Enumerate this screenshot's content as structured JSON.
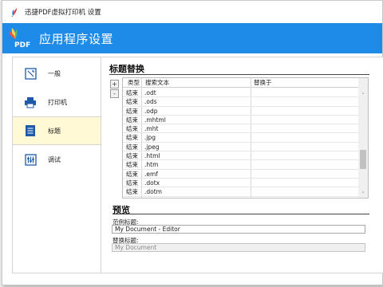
{
  "window": {
    "title": "迅捷PDF虚拟打印机 设置",
    "header_title": "应用程序设置",
    "logo_text": "PDF"
  },
  "sidebar": {
    "items": [
      {
        "label": "一般",
        "icon": "general-settings-icon",
        "active": false
      },
      {
        "label": "打印机",
        "icon": "printer-icon",
        "active": false
      },
      {
        "label": "标题",
        "icon": "title-document-icon",
        "active": true
      },
      {
        "label": "调试",
        "icon": "debug-icon",
        "active": false
      }
    ]
  },
  "title_replace": {
    "heading": "标题替换",
    "add_label": "+",
    "remove_label": "-",
    "columns": [
      "类型",
      "搜索文本",
      "替换于"
    ],
    "rows": [
      {
        "type": "结束",
        "search": ".odt",
        "replace": ""
      },
      {
        "type": "结束",
        "search": ".ods",
        "replace": ""
      },
      {
        "type": "结束",
        "search": ".odp",
        "replace": ""
      },
      {
        "type": "结束",
        "search": ".mhtml",
        "replace": ""
      },
      {
        "type": "结束",
        "search": ".mht",
        "replace": ""
      },
      {
        "type": "结束",
        "search": ".jpg",
        "replace": ""
      },
      {
        "type": "结束",
        "search": ".jpeg",
        "replace": ""
      },
      {
        "type": "结束",
        "search": ".html",
        "replace": ""
      },
      {
        "type": "结束",
        "search": ".htm",
        "replace": ""
      },
      {
        "type": "结束",
        "search": ".emf",
        "replace": ""
      },
      {
        "type": "结束",
        "search": ".dotx",
        "replace": ""
      },
      {
        "type": "结束",
        "search": ".dotm",
        "replace": ""
      },
      {
        "type": "结束",
        "search": "",
        "replace": ""
      }
    ],
    "scroll_up": "˄",
    "scroll_down": "˅"
  },
  "preview": {
    "heading": "预览",
    "sample_label": "范例标题:",
    "sample_value": "My Document - Editor",
    "replaced_label": "替换标题:",
    "replaced_value": "My Document"
  },
  "colors": {
    "header": "#1e8be8",
    "active_item": "#fff9d6"
  }
}
